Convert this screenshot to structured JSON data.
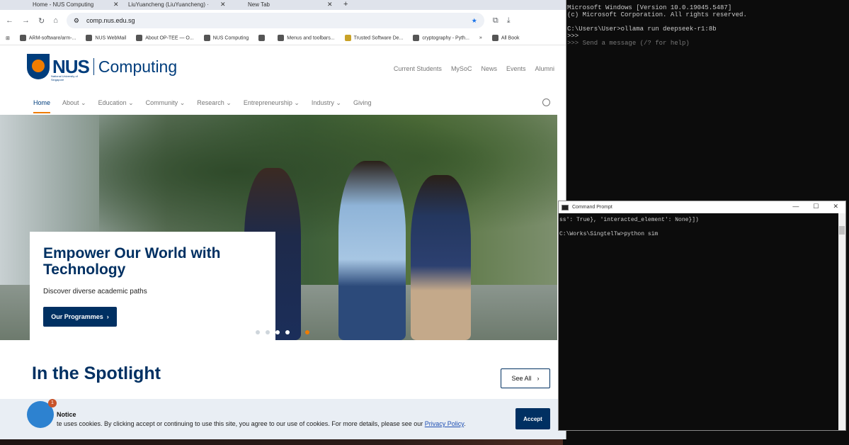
{
  "browser": {
    "tabs": [
      {
        "label": "Home - NUS Computing"
      },
      {
        "label": "LiuYuancheng (LiuYuancheng) ·"
      },
      {
        "label": "New Tab"
      }
    ],
    "url": "comp.nus.edu.sg",
    "bookmarks": [
      "ARM-software/arm-...",
      "NUS WebMail",
      "About OP-TEE — O...",
      "NUS Computing",
      "",
      "Menus and toolbars...",
      "Trusted Software De...",
      "cryptography - Pyth..."
    ],
    "bookmarks_more": "»",
    "all_bookmarks": "All Book"
  },
  "site": {
    "logo": {
      "nus": "NUS",
      "sub": "National University of Singapore",
      "computing": "Computing"
    },
    "util_links": [
      "Current Students",
      "MySoC",
      "News",
      "Events",
      "Alumni"
    ],
    "nav": [
      "Home",
      "About",
      "Education",
      "Community",
      "Research",
      "Entrepreneurship",
      "Industry",
      "Giving"
    ],
    "hero": {
      "title": "Empower Our World with Technology",
      "subtitle": "Discover diverse academic paths",
      "button": "Our Programmes",
      "slides": 6,
      "active_slide": 5
    },
    "spotlight": {
      "title": "In the Spotlight",
      "see_all": "See All"
    },
    "notice": {
      "title": "Notice",
      "text": "te uses cookies. By clicking accept or continuing to use this site, you agree to our use of cookies. For more details, please see our ",
      "link": "Privacy Policy",
      "after": ".",
      "accept": "Accept",
      "badge": "1"
    }
  },
  "console_top": {
    "lines": [
      "Microsoft Windows [Version 10.0.19045.5487]",
      "(c) Microsoft Corporation. All rights reserved.",
      "",
      "C:\\Users\\User>ollama run deepseek-r1:8b",
      ">>>",
      ">>> Send a message (/? for help)"
    ]
  },
  "cmd": {
    "title": "Command Prompt",
    "lines": [
      "ss': True}, 'interacted_element': None}])",
      "",
      "C:\\Works\\SingtelTw>python sim"
    ]
  },
  "colors": {
    "nus_blue": "#003062",
    "nus_orange": "#ef7c00"
  }
}
